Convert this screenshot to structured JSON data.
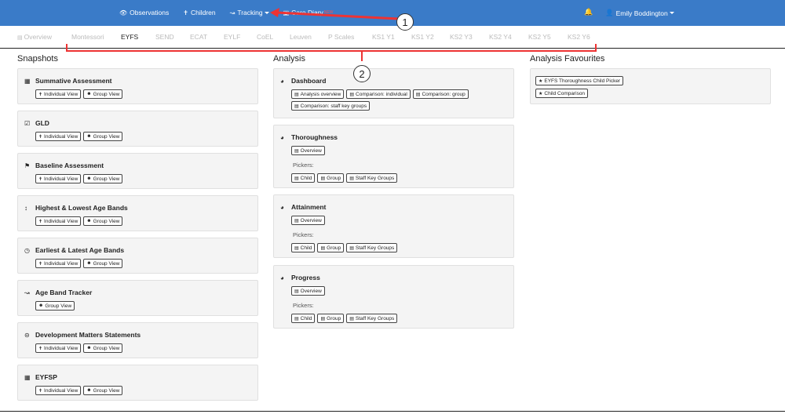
{
  "topnav": {
    "items": [
      {
        "label": "Observations",
        "icon": "eye-icon"
      },
      {
        "label": "Children",
        "icon": "child-icon"
      },
      {
        "label": "Tracking",
        "icon": "chart-icon"
      },
      {
        "label": "Care Diary",
        "icon": "book-icon",
        "badge": "NEW"
      }
    ],
    "user_name": "Emily Boddington"
  },
  "subtabs": [
    "Overview",
    "Montessori",
    "EYFS",
    "SEND",
    "ECAT",
    "EYLF",
    "CoEL",
    "Leuven",
    "P Scales",
    "KS1 Y1",
    "KS1 Y2",
    "KS2 Y3",
    "KS2 Y4",
    "KS2 Y5",
    "KS2 Y6"
  ],
  "sections": {
    "snapshots": "Snapshots",
    "analysis": "Analysis",
    "favourites": "Analysis Favourites"
  },
  "snapshots": [
    {
      "title": "Summative Assessment",
      "icon": "calendar-icon",
      "buttons": [
        "Individual View",
        "Group View"
      ]
    },
    {
      "title": "GLD",
      "icon": "calendar-check-icon",
      "buttons": [
        "Individual View",
        "Group View"
      ]
    },
    {
      "title": "Baseline Assessment",
      "icon": "flag-icon",
      "buttons": [
        "Individual View",
        "Group View"
      ]
    },
    {
      "title": "Highest & Lowest Age Bands",
      "icon": "vertical-arrows-icon",
      "buttons": [
        "Individual View",
        "Group View"
      ]
    },
    {
      "title": "Earliest & Latest Age Bands",
      "icon": "clock-icon",
      "buttons": [
        "Individual View",
        "Group View"
      ]
    },
    {
      "title": "Age Band Tracker",
      "icon": "line-chart-icon",
      "buttons": [
        "Group View"
      ]
    },
    {
      "title": "Development Matters Statements",
      "icon": "check-circle-icon",
      "buttons": [
        "Individual View",
        "Group View"
      ]
    },
    {
      "title": "EYFSP",
      "icon": "calendar-icon",
      "buttons": [
        "Individual View",
        "Group View"
      ]
    }
  ],
  "analysis": {
    "dashboard": {
      "title": "Dashboard",
      "buttons": [
        "Analysis overview",
        "Comparison: individual",
        "Comparison: group",
        "Comparison: staff key groups"
      ]
    },
    "thoroughness": {
      "title": "Thoroughness",
      "overview": "Overview",
      "pickers_label": "Pickers:",
      "pickers": [
        "Child",
        "Group",
        "Staff Key Groups"
      ]
    },
    "attainment": {
      "title": "Attainment",
      "overview": "Overview",
      "pickers_label": "Pickers:",
      "pickers": [
        "Child",
        "Group",
        "Staff Key Groups"
      ]
    },
    "progress": {
      "title": "Progress",
      "overview": "Overview",
      "pickers_label": "Pickers:",
      "pickers": [
        "Child",
        "Group",
        "Staff Key Groups"
      ]
    }
  },
  "favourites": [
    "EYFS Thoroughness Child Picker",
    "Child Comparison"
  ],
  "annotations": {
    "one": "1",
    "two": "2"
  },
  "colors": {
    "topbar": "#3a7bc8",
    "annotation": "#e33333"
  }
}
